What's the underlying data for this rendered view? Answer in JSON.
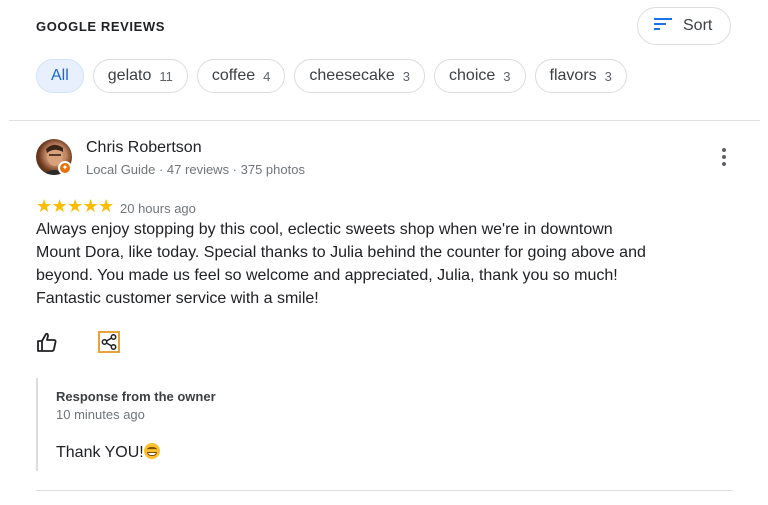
{
  "header": {
    "title": "GOOGLE REVIEWS",
    "sort_label": "Sort"
  },
  "filters": [
    {
      "label": "All",
      "count": "",
      "active": true
    },
    {
      "label": "gelato",
      "count": "11"
    },
    {
      "label": "coffee",
      "count": "4"
    },
    {
      "label": "cheesecake",
      "count": "3"
    },
    {
      "label": "choice",
      "count": "3"
    },
    {
      "label": "flavors",
      "count": "3"
    }
  ],
  "review": {
    "author": "Chris Robertson",
    "meta": "Local Guide · 47 reviews · 375 photos",
    "rating": 5,
    "time": "20 hours ago",
    "text_lines": [
      "Always enjoy stopping by this cool, eclectic sweets shop when we're in downtown",
      "Mount Dora, like today. Special thanks to Julia behind the counter for going above and",
      "beyond. You made us feel so welcome and appreciated, Julia, thank you so much!",
      "Fantastic customer service with a smile!"
    ],
    "owner_response": {
      "title": "Response from the owner",
      "time": "10 minutes ago",
      "text": "Thank YOU!"
    }
  },
  "icons": {
    "sort": "sort-icon",
    "more": "more-vert-icon",
    "like": "thumbs-up-icon",
    "share": "share-icon",
    "emoji": "grinning-face-emoji",
    "guide": "local-guide-badge-icon"
  },
  "colors": {
    "star": "#fbbc04",
    "active_chip_bg": "#e8f0fe",
    "active_chip_text": "#1967d2",
    "share_focus": "#e6a23c"
  }
}
